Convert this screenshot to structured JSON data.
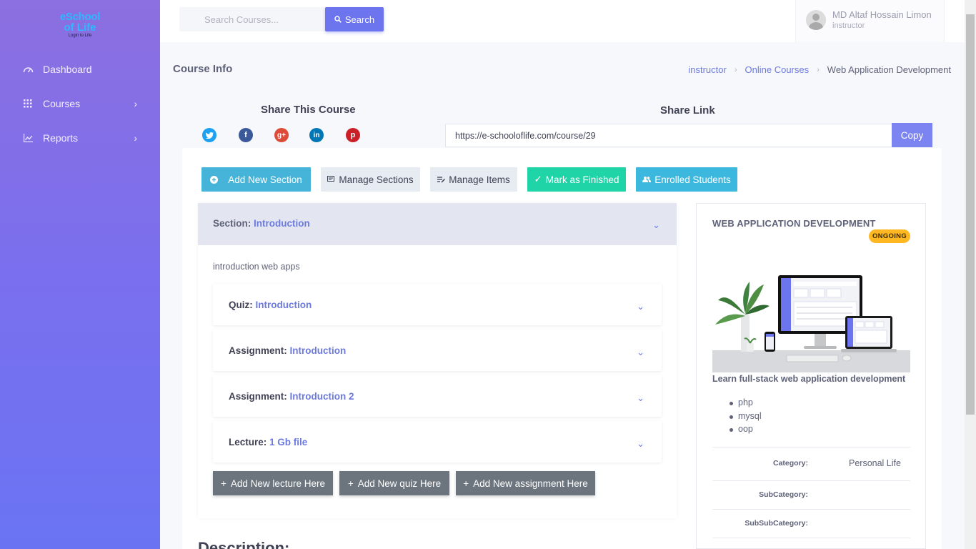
{
  "logo": {
    "line1": "eSchool",
    "line2": "of Life",
    "tagline": "Login to Life"
  },
  "sidebar": {
    "items": [
      {
        "label": "Dashboard",
        "icon": "speedometer-icon"
      },
      {
        "label": "Courses",
        "icon": "grid-icon",
        "chevron": "›"
      },
      {
        "label": "Reports",
        "icon": "chart-icon",
        "chevron": "›"
      }
    ]
  },
  "topbar": {
    "search_placeholder": "Search Courses...",
    "search_button": "Search",
    "user_name": "MD Altaf Hossain Limon",
    "user_role": "instructor"
  },
  "page": {
    "title": "Course Info",
    "breadcrumb": [
      "instructor",
      "Online Courses",
      "Web Application Development"
    ]
  },
  "share": {
    "title": "Share This Course",
    "link_title": "Share Link",
    "link_value": "https://e-schooloflife.com/course/29",
    "copy_button": "Copy",
    "networks": [
      {
        "name": "twitter",
        "glyph": "t",
        "color": "#1da1f2"
      },
      {
        "name": "facebook",
        "glyph": "f",
        "color": "#3b5998"
      },
      {
        "name": "google-plus",
        "glyph": "g+",
        "color": "#dd4b39"
      },
      {
        "name": "linkedin",
        "glyph": "in",
        "color": "#0077b5"
      },
      {
        "name": "pinterest",
        "glyph": "p",
        "color": "#cb2027"
      }
    ]
  },
  "actions": {
    "add_section": "Add New Section",
    "manage_sections": "Manage Sections",
    "manage_items": "Manage Items",
    "mark_finished": "Mark as Finished",
    "enrolled_students": "Enrolled Students"
  },
  "section": {
    "prefix": "Section:",
    "name": "Introduction",
    "description": "introduction web apps",
    "items": [
      {
        "type": "Quiz:",
        "name": "Introduction"
      },
      {
        "type": "Assignment:",
        "name": "Introduction"
      },
      {
        "type": "Assignment:",
        "name": "Introduction 2"
      },
      {
        "type": "Lecture:",
        "name": "1 Gb file"
      }
    ],
    "add_lecture": "Add New lecture Here",
    "add_quiz": "Add New quiz Here",
    "add_assignment": "Add New assignment Here"
  },
  "description_heading": "Description:",
  "course": {
    "title": "WEB APPLICATION DEVELOPMENT",
    "status": "ONGOING",
    "subtitle": "Learn full-stack web application development",
    "tags": [
      "php",
      "mysql",
      "oop"
    ],
    "meta": [
      {
        "key": "Category:",
        "value": "Personal Life"
      },
      {
        "key": "SubCategory:",
        "value": ""
      },
      {
        "key": "SubSubCategory:",
        "value": ""
      }
    ]
  },
  "colors": {
    "accent": "#6c7ae0",
    "sidebar_start": "#8c6fe0",
    "sidebar_end": "#6a74f3",
    "success": "#1fd4a6",
    "info": "#45b4d8",
    "warning": "#ffb822"
  }
}
